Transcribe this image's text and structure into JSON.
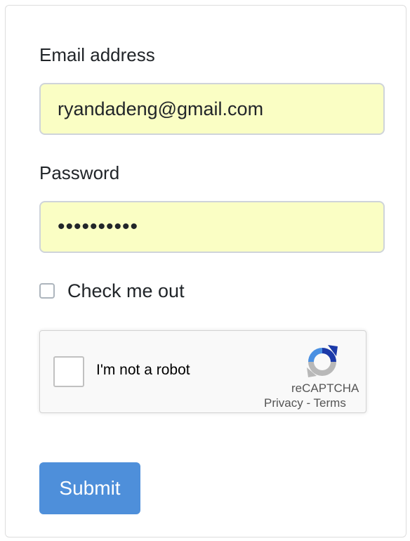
{
  "form": {
    "email_label": "Email address",
    "email_value": "ryandadeng@gmail.com",
    "password_label": "Password",
    "password_value": "••••••••••",
    "checkbox_label": "Check me out",
    "submit_label": "Submit"
  },
  "recaptcha": {
    "checkbox_text": "I'm not a robot",
    "brand": "reCAPTCHA",
    "privacy_link": "Privacy",
    "separator": " - ",
    "terms_link": "Terms"
  },
  "colors": {
    "input_autofill_bg": "#fafec4",
    "submit_bg": "#4e8fda",
    "recaptcha_blue": "#4a90e2",
    "recaptcha_dark_blue": "#1c3aa9",
    "recaptcha_gray": "#b8b8b8"
  },
  "icons": {
    "recaptcha_logo": "recaptcha-logo-icon"
  }
}
